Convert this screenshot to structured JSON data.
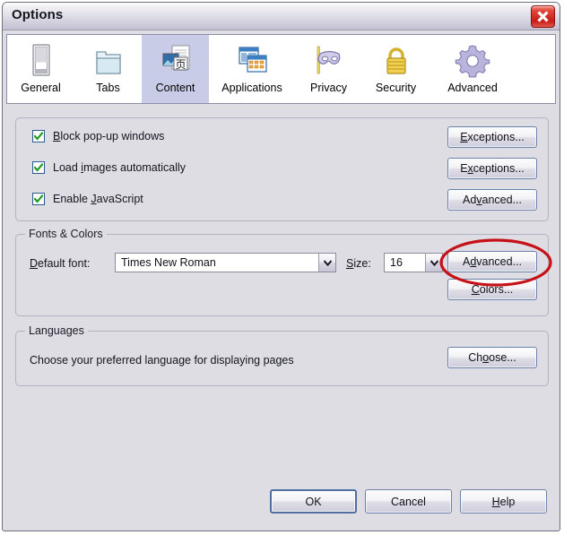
{
  "window": {
    "title": "Options",
    "close_icon": "close-x-icon"
  },
  "tabs": [
    {
      "label": "General",
      "icon": "page-window-icon",
      "selected": false
    },
    {
      "label": "Tabs",
      "icon": "folder-tabs-icon",
      "selected": false
    },
    {
      "label": "Content",
      "icon": "content-page-icon",
      "selected": true
    },
    {
      "label": "Applications",
      "icon": "two-windows-icon",
      "selected": false
    },
    {
      "label": "Privacy",
      "icon": "mask-icon",
      "selected": false
    },
    {
      "label": "Security",
      "icon": "padlock-icon",
      "selected": false
    },
    {
      "label": "Advanced",
      "icon": "gear-icon",
      "selected": false
    }
  ],
  "content_group": {
    "checkboxes": [
      {
        "label_pre": "",
        "accel": "B",
        "label_post": "lock pop-up windows",
        "checked": true,
        "button": {
          "label_pre": "",
          "accel": "E",
          "label_post": "xceptions..."
        }
      },
      {
        "label_pre": "Load ",
        "accel": "i",
        "label_post": "mages automatically",
        "checked": true,
        "button": {
          "label_pre": "E",
          "accel": "x",
          "label_post": "ceptions..."
        }
      },
      {
        "label_pre": "Enable ",
        "accel": "J",
        "label_post": "avaScript",
        "checked": true,
        "button": {
          "label_pre": "Ad",
          "accel": "v",
          "label_post": "anced..."
        }
      }
    ]
  },
  "fonts_group": {
    "title": "Fonts & Colors",
    "default_font_label_pre": "",
    "default_font_label_accel": "D",
    "default_font_label_post": "efault font:",
    "default_font_value": "Times New Roman",
    "size_label_pre": "",
    "size_label_accel": "S",
    "size_label_post": "ize:",
    "size_value": "16",
    "advanced_button": {
      "pre": "A",
      "accel": "d",
      "post": "vanced..."
    },
    "colors_button": {
      "pre": "",
      "accel": "C",
      "post": "olors..."
    }
  },
  "languages_group": {
    "title": "Languages",
    "description": "Choose your preferred language for displaying pages",
    "choose_button": {
      "pre": "Ch",
      "accel": "o",
      "post": "ose..."
    }
  },
  "footer": {
    "ok": {
      "pre": "OK",
      "accel": "",
      "post": ""
    },
    "cancel": {
      "pre": "Cancel",
      "accel": "",
      "post": ""
    },
    "help": {
      "pre": "",
      "accel": "H",
      "post": "elp"
    }
  },
  "annotation": {
    "type": "red-ellipse-highlight",
    "target": "fonts-advanced-button",
    "color": "#c61118"
  }
}
